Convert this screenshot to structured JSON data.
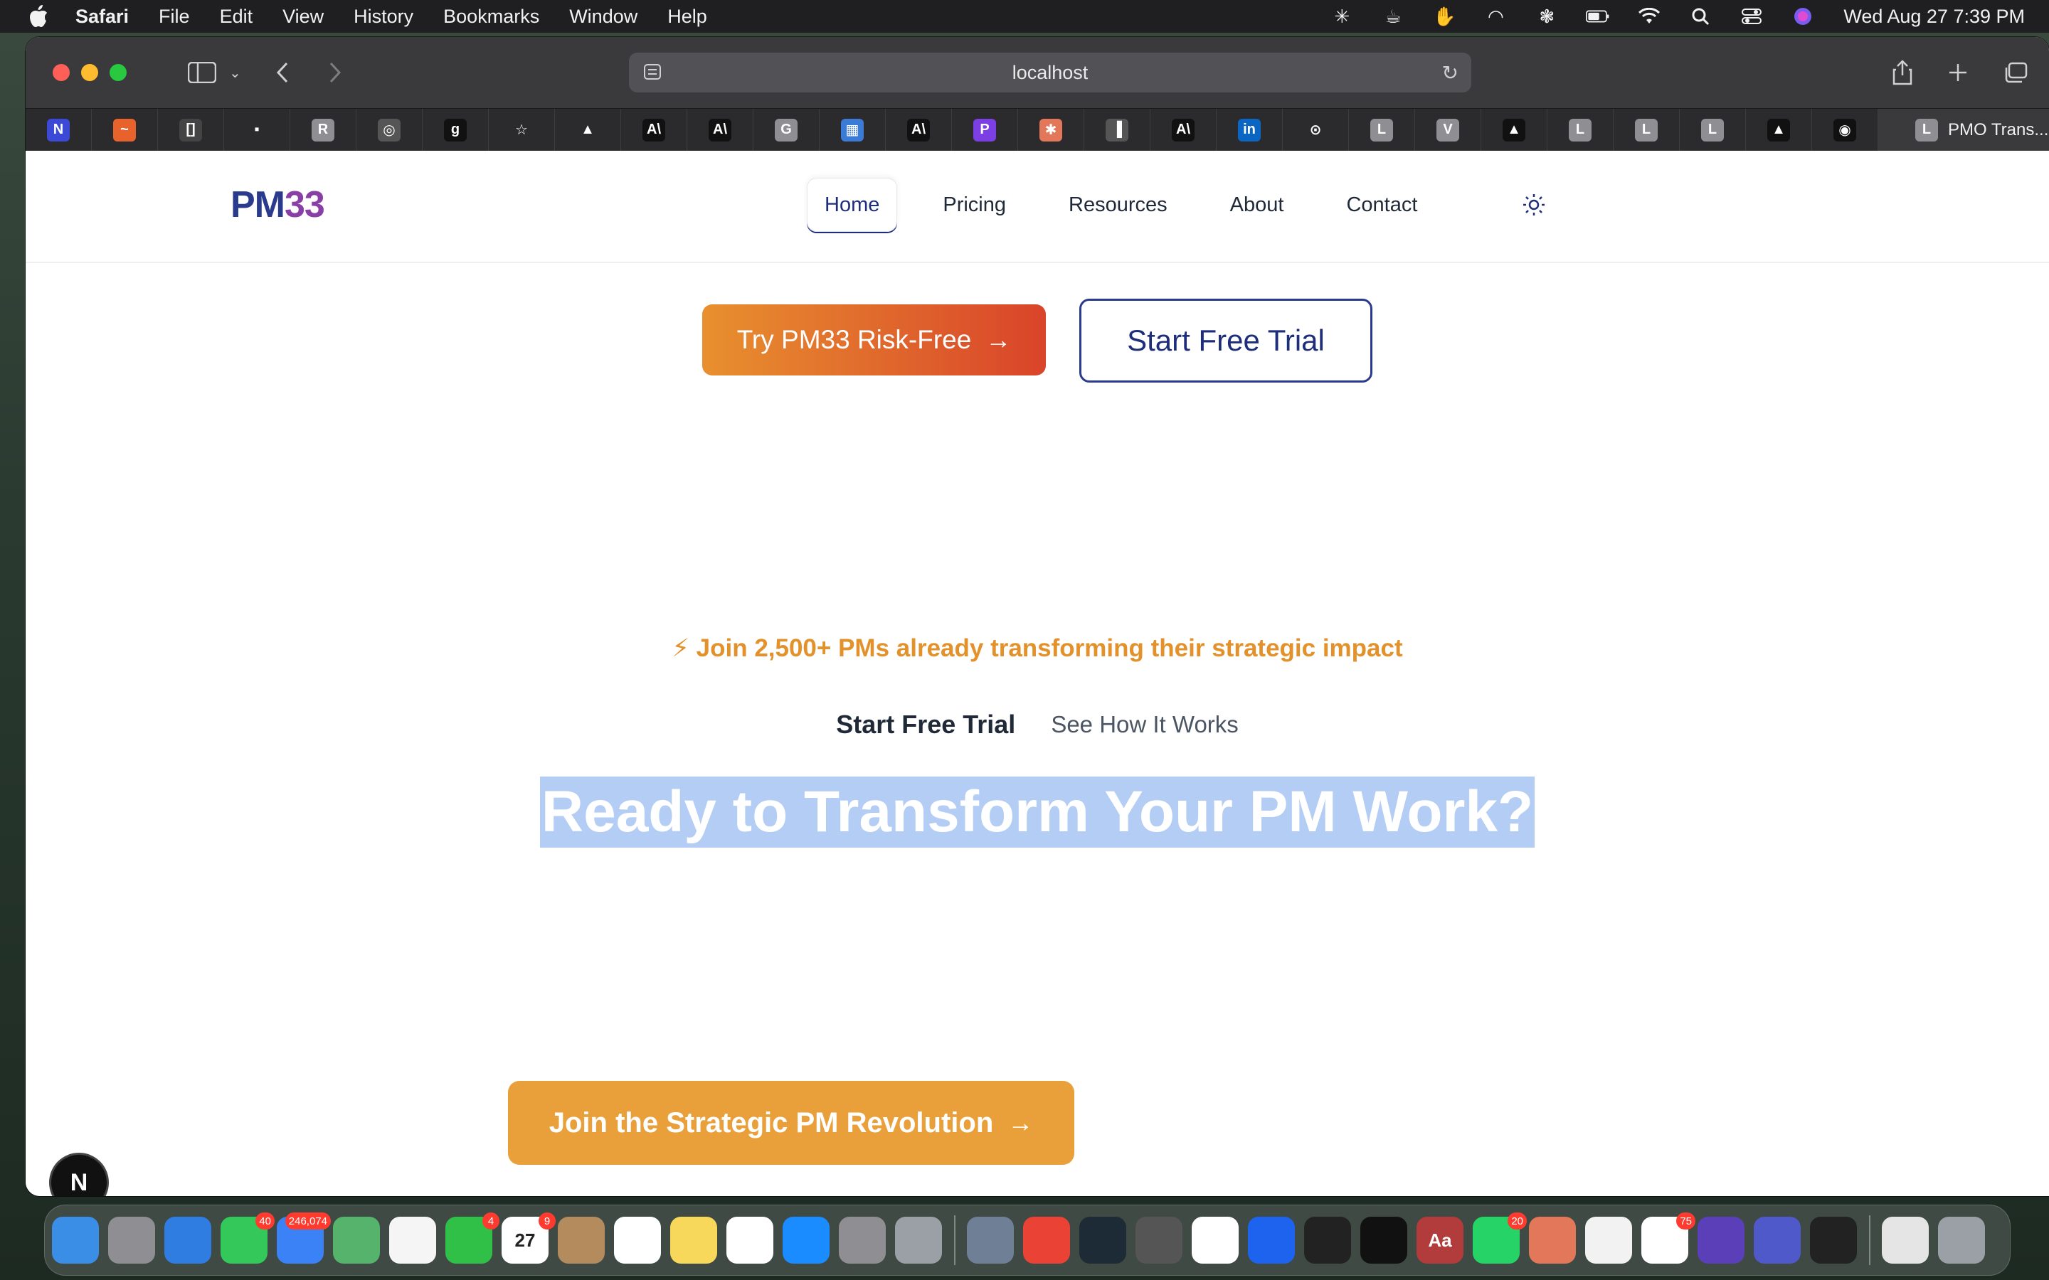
{
  "menubar": {
    "app_name": "Safari",
    "items": [
      "File",
      "Edit",
      "View",
      "History",
      "Bookmarks",
      "Window",
      "Help"
    ],
    "clock": "Wed Aug 27  7:39 PM"
  },
  "browser": {
    "address": "localhost",
    "active_tab_title": "PMO Trans...",
    "active_tab_letter": "L",
    "favorites": [
      {
        "letter": "N",
        "color": "#3b49d6"
      },
      {
        "letter": "~",
        "color": "#e8622c"
      },
      {
        "letter": "[]",
        "color": "#444"
      },
      {
        "letter": "▪",
        "color": "#2b2b2d"
      },
      {
        "letter": "R",
        "color": "#8e8e93"
      },
      {
        "letter": "◎",
        "color": "#555"
      },
      {
        "letter": "g",
        "color": "#111"
      },
      {
        "letter": "☆",
        "color": "#2b2b2d"
      },
      {
        "letter": "▲",
        "color": "#2b2b2d"
      },
      {
        "letter": "A\\",
        "color": "#111"
      },
      {
        "letter": "A\\",
        "color": "#111"
      },
      {
        "letter": "G",
        "color": "#8e8e93"
      },
      {
        "letter": "▦",
        "color": "#3b7bd6"
      },
      {
        "letter": "A\\",
        "color": "#111"
      },
      {
        "letter": "P",
        "color": "#7b3fe4"
      },
      {
        "letter": "✱",
        "color": "#e2775a"
      },
      {
        "letter": "▐",
        "color": "#555"
      },
      {
        "letter": "A\\",
        "color": "#111"
      },
      {
        "letter": "in",
        "color": "#0a66c2"
      },
      {
        "letter": "⊙",
        "color": "#2b2b2d"
      },
      {
        "letter": "L",
        "color": "#8e8e93"
      },
      {
        "letter": "V",
        "color": "#8e8e93"
      },
      {
        "letter": "▲",
        "color": "#111"
      },
      {
        "letter": "L",
        "color": "#8e8e93"
      },
      {
        "letter": "L",
        "color": "#8e8e93"
      },
      {
        "letter": "L",
        "color": "#8e8e93"
      },
      {
        "letter": "▲",
        "color": "#111"
      },
      {
        "letter": "◉",
        "color": "#111"
      }
    ]
  },
  "site": {
    "logo_pm": "PM",
    "logo_num": "33",
    "nav": [
      "Home",
      "Pricing",
      "Resources",
      "About",
      "Contact"
    ],
    "hero_primary_cta": "Try PM33 Risk-Free",
    "hero_secondary_cta": "Start Free Trial",
    "social_proof": "⚡ Join 2,500+ PMs already transforming their strategic impact",
    "link_primary": "Start Free Trial",
    "link_secondary": "See How It Works",
    "cta_heading": "Ready to Transform Your PM Work?",
    "join_cta": "Join the Strategic PM Revolution",
    "dev_badge": "N"
  },
  "dock": {
    "apps": [
      {
        "name": "Finder",
        "color": "#3a8ee6",
        "label": ""
      },
      {
        "name": "Launchpad",
        "color": "#8e8e93",
        "label": ""
      },
      {
        "name": "Safari",
        "color": "#2f7de1",
        "label": ""
      },
      {
        "name": "Messages",
        "color": "#34c759",
        "label": "",
        "badge": "40"
      },
      {
        "name": "Mail",
        "color": "#3b82f6",
        "label": "",
        "badge": "246,074"
      },
      {
        "name": "Maps",
        "color": "#55b36b",
        "label": ""
      },
      {
        "name": "Photos",
        "color": "#f5f5f5",
        "label": ""
      },
      {
        "name": "FaceTime",
        "color": "#30c048",
        "label": "",
        "badge": "4"
      },
      {
        "name": "Calendar",
        "color": "#ffffff",
        "label": "27",
        "badge": "9"
      },
      {
        "name": "Contacts",
        "color": "#b38b5d",
        "label": ""
      },
      {
        "name": "Reminders",
        "color": "#ffffff",
        "label": ""
      },
      {
        "name": "Notes",
        "color": "#f7d85a",
        "label": ""
      },
      {
        "name": "Freeform",
        "color": "#ffffff",
        "label": ""
      },
      {
        "name": "App Store",
        "color": "#1a8cff",
        "label": ""
      },
      {
        "name": "System Settings",
        "color": "#8e8e93",
        "label": ""
      },
      {
        "name": "iPhone Mirroring",
        "color": "#9aa0a6",
        "label": ""
      },
      {
        "name": "Preview",
        "color": "#6e7f96",
        "label": ""
      },
      {
        "name": "Chrome",
        "color": "#ea4335",
        "label": ""
      },
      {
        "name": "Cursor",
        "color": "#1c2b36",
        "label": ""
      },
      {
        "name": "Calculator",
        "color": "#555",
        "label": ""
      },
      {
        "name": "Arc",
        "color": "#ffffff",
        "label": ""
      },
      {
        "name": "Docker",
        "color": "#1d63ed",
        "label": ""
      },
      {
        "name": "Activity Monitor",
        "color": "#222",
        "label": ""
      },
      {
        "name": "Terminal",
        "color": "#111",
        "label": ""
      },
      {
        "name": "Dictionary",
        "color": "#b23b3b",
        "label": "Aa"
      },
      {
        "name": "WhatsApp",
        "color": "#25d366",
        "label": "",
        "badge": "20"
      },
      {
        "name": "Claude",
        "color": "#e2775a",
        "label": ""
      },
      {
        "name": "TextEdit",
        "color": "#f2f2f2",
        "label": ""
      },
      {
        "name": "Slack",
        "color": "#ffffff",
        "label": "",
        "badge": "75"
      },
      {
        "name": "Obsidian",
        "color": "#5b3fb8",
        "label": ""
      },
      {
        "name": "Teams",
        "color": "#5059c9",
        "label": ""
      },
      {
        "name": "Sandbox",
        "color": "#222",
        "label": ""
      },
      {
        "name": "Downloads",
        "color": "#e5e5e5",
        "label": ""
      },
      {
        "name": "Trash",
        "color": "#9aa0a6",
        "label": ""
      }
    ]
  }
}
